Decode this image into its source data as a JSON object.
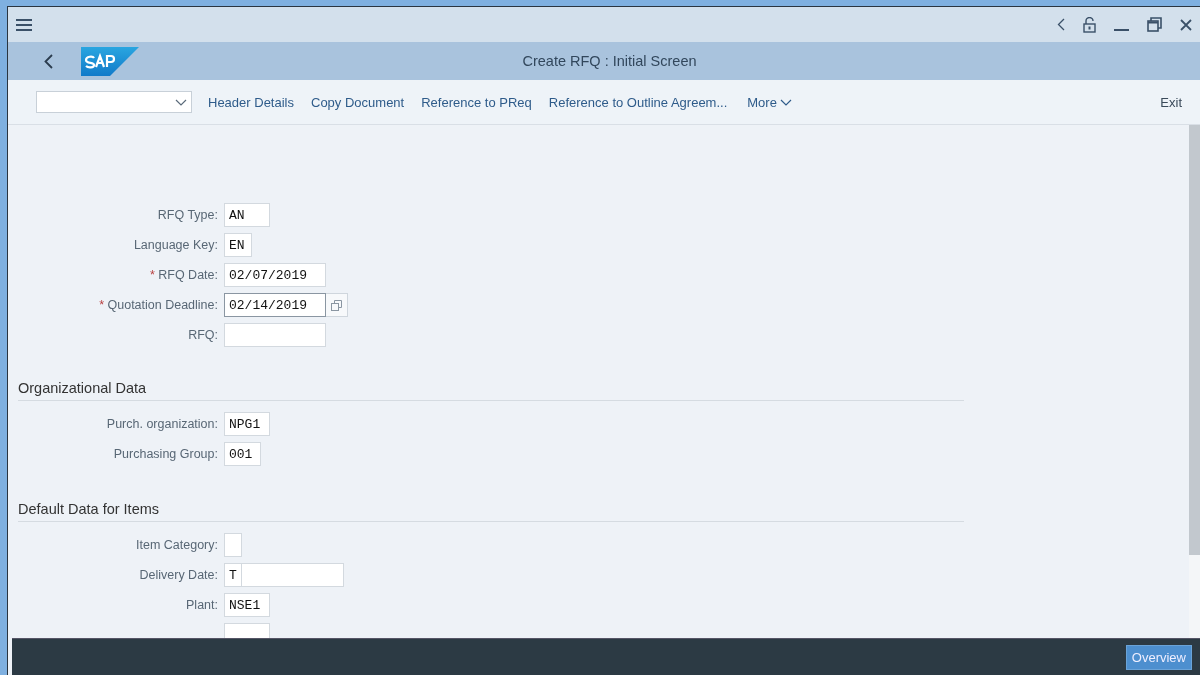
{
  "window": {
    "title": "Create RFQ : Initial Screen"
  },
  "toolbar": {
    "actions": [
      "Header Details",
      "Copy Document",
      "Reference to PReq",
      "Reference to Outline Agreem..."
    ],
    "more": "More",
    "exit": "Exit"
  },
  "sections": [
    {
      "fields": [
        {
          "kind": "field",
          "label": "RFQ Type:",
          "value": "AN"
        },
        {
          "kind": "field",
          "label": "Language Key:",
          "value": "EN"
        },
        {
          "kind": "field",
          "required_mark": "*",
          "label": "RFQ Date:",
          "value": "02/07/2019"
        },
        {
          "kind": "help",
          "required_mark": "*",
          "label": "Quotation Deadline:",
          "value": "02/14/2019"
        },
        {
          "kind": "field",
          "label": "RFQ:"
        }
      ]
    },
    {
      "title": "Organizational Data",
      "fields": [
        {
          "kind": "field",
          "label": "Purch. organization:",
          "value": "NPG1"
        },
        {
          "kind": "field",
          "label": "Purchasing Group:",
          "value": "001"
        }
      ]
    },
    {
      "title": "Default Data for Items",
      "fields": [
        {
          "kind": "field",
          "label": "Item Category:"
        },
        {
          "kind": "split",
          "label": "Delivery Date:",
          "value": "T"
        },
        {
          "kind": "field",
          "label": "Plant:",
          "value": "NSE1"
        },
        {
          "kind": "field"
        }
      ]
    }
  ],
  "footer": {
    "button": "Overview"
  }
}
